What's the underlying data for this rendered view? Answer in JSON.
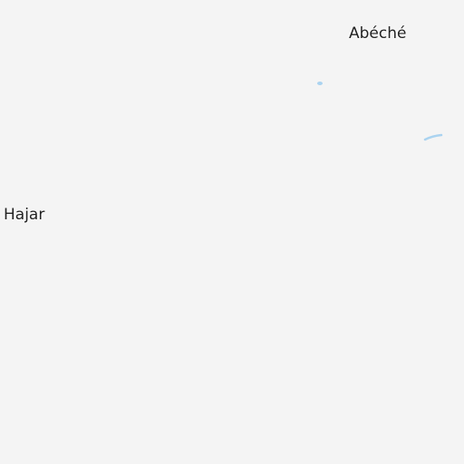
{
  "map": {
    "background_color": "#f4f4f4",
    "water_color": "#aad3f0",
    "places": {
      "abeche": "Abéché",
      "hajar": "Hajar"
    }
  }
}
